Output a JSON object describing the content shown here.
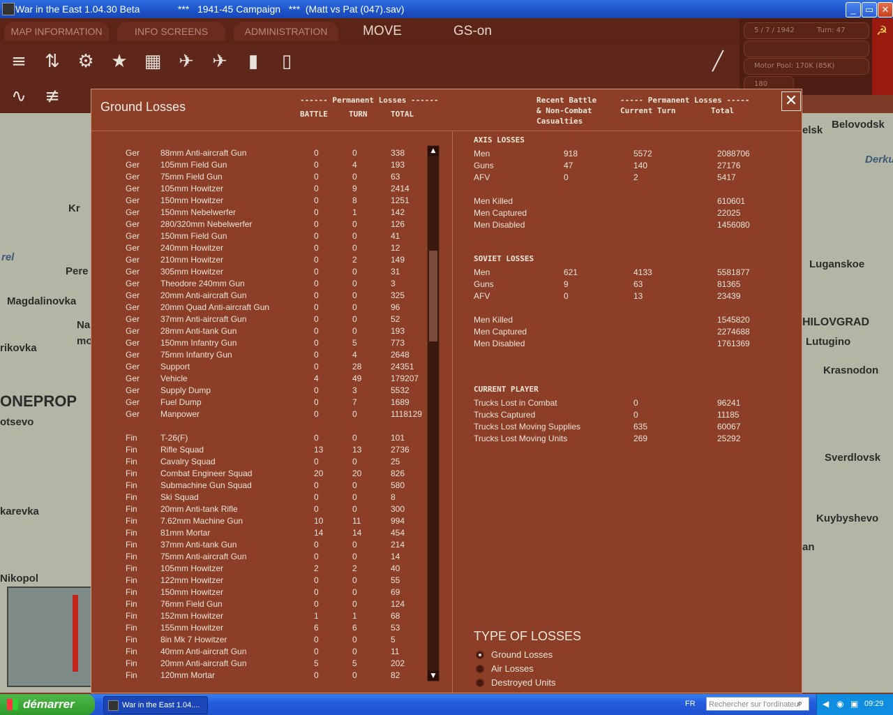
{
  "window": {
    "title": "War in the East 1.04.30 Beta              ***   1941-45 Campaign   ***  (Matt vs Pat (047).sav)",
    "min": "_",
    "max": "▭",
    "close": "✕"
  },
  "menu": {
    "tabs": [
      "MAP INFORMATION",
      "INFO SCREENS",
      "ADMINISTRATION"
    ],
    "mode": "MOVE",
    "gs": "GS-on"
  },
  "info": {
    "date": "5 / 7 / 1942",
    "turn": "Turn: 47",
    "motor_pool": "Motor Pool:  170K (85K)",
    "value": "180"
  },
  "map_labels": [
    "Belovodsk",
    "Derkul",
    "Luganskoe",
    "HILOVGRAD",
    "Lutugino",
    "Krasnodon",
    "Sverdlovsk",
    "Kuybyshevo",
    "Magdalinovka",
    "Pere",
    "Kr",
    "ONEPROP",
    "otsevo",
    "karevka",
    "Nikopol",
    "elsk",
    "rikovka",
    "an",
    "Na",
    "mo",
    "rel"
  ],
  "dialog": {
    "title": "Ground Losses",
    "close": "✕",
    "left_headers": {
      "group": "------ Permanent Losses ------",
      "battle": "BATTLE",
      "turn": "TURN",
      "total": "TOTAL"
    },
    "right_headers": {
      "recent": "Recent Battle\n& Non-Combat\nCasualties",
      "group": "----- Permanent Losses -----",
      "current": "Current Turn",
      "total": "Total"
    },
    "rows": [
      [
        "Ger",
        "88mm Anti-aircraft Gun",
        "0",
        "0",
        "338"
      ],
      [
        "Ger",
        "105mm Field Gun",
        "0",
        "4",
        "193"
      ],
      [
        "Ger",
        "75mm Field Gun",
        "0",
        "0",
        "63"
      ],
      [
        "Ger",
        "105mm Howitzer",
        "0",
        "9",
        "2414"
      ],
      [
        "Ger",
        "150mm Howitzer",
        "0",
        "8",
        "1251"
      ],
      [
        "Ger",
        "150mm Nebelwerfer",
        "0",
        "1",
        "142"
      ],
      [
        "Ger",
        "280/320mm Nebelwerfer",
        "0",
        "0",
        "126"
      ],
      [
        "Ger",
        "150mm Field Gun",
        "0",
        "0",
        "41"
      ],
      [
        "Ger",
        "240mm Howitzer",
        "0",
        "0",
        "12"
      ],
      [
        "Ger",
        "210mm Howitzer",
        "0",
        "2",
        "149"
      ],
      [
        "Ger",
        "305mm Howitzer",
        "0",
        "0",
        "31"
      ],
      [
        "Ger",
        "Theodore 240mm Gun",
        "0",
        "0",
        "3"
      ],
      [
        "Ger",
        "20mm Anti-aircraft Gun",
        "0",
        "0",
        "325"
      ],
      [
        "Ger",
        "20mm Quad Anti-aircraft Gun",
        "0",
        "0",
        "96"
      ],
      [
        "Ger",
        "37mm Anti-aircraft Gun",
        "0",
        "0",
        "52"
      ],
      [
        "Ger",
        "28mm Anti-tank Gun",
        "0",
        "0",
        "193"
      ],
      [
        "Ger",
        "150mm Infantry Gun",
        "0",
        "5",
        "773"
      ],
      [
        "Ger",
        "75mm Infantry Gun",
        "0",
        "4",
        "2648"
      ],
      [
        "Ger",
        "Support",
        "0",
        "28",
        "24351"
      ],
      [
        "Ger",
        "Vehicle",
        "4",
        "49",
        "179207"
      ],
      [
        "Ger",
        "Supply Dump",
        "0",
        "3",
        "5532"
      ],
      [
        "Ger",
        "Fuel Dump",
        "0",
        "7",
        "1689"
      ],
      [
        "Ger",
        "Manpower",
        "0",
        "0",
        "1118129"
      ],
      [
        "",
        "",
        "",
        "",
        ""
      ],
      [
        "Fin",
        "T-26(F)",
        "0",
        "0",
        "101"
      ],
      [
        "Fin",
        "Rifle Squad",
        "13",
        "13",
        "2736"
      ],
      [
        "Fin",
        "Cavalry Squad",
        "0",
        "0",
        "25"
      ],
      [
        "Fin",
        "Combat Engineer Squad",
        "20",
        "20",
        "826"
      ],
      [
        "Fin",
        "Submachine Gun Squad",
        "0",
        "0",
        "580"
      ],
      [
        "Fin",
        "Ski Squad",
        "0",
        "0",
        "8"
      ],
      [
        "Fin",
        "20mm Anti-tank Rifle",
        "0",
        "0",
        "300"
      ],
      [
        "Fin",
        "7.62mm Machine Gun",
        "10",
        "11",
        "994"
      ],
      [
        "Fin",
        "81mm Mortar",
        "14",
        "14",
        "454"
      ],
      [
        "Fin",
        "37mm Anti-tank Gun",
        "0",
        "0",
        "214"
      ],
      [
        "Fin",
        "75mm Anti-aircraft Gun",
        "0",
        "0",
        "14"
      ],
      [
        "Fin",
        "105mm Howitzer",
        "2",
        "2",
        "40"
      ],
      [
        "Fin",
        "122mm Howitzer",
        "0",
        "0",
        "55"
      ],
      [
        "Fin",
        "150mm Howitzer",
        "0",
        "0",
        "69"
      ],
      [
        "Fin",
        "76mm Field Gun",
        "0",
        "0",
        "124"
      ],
      [
        "Fin",
        "152mm Howitzer",
        "1",
        "1",
        "68"
      ],
      [
        "Fin",
        "155mm Howitzer",
        "6",
        "6",
        "53"
      ],
      [
        "Fin",
        "8in Mk 7 Howitzer",
        "0",
        "0",
        "5"
      ],
      [
        "Fin",
        "40mm Anti-aircraft Gun",
        "0",
        "0",
        "11"
      ],
      [
        "Fin",
        "20mm Anti-aircraft Gun",
        "5",
        "5",
        "202"
      ],
      [
        "Fin",
        "120mm Mortar",
        "0",
        "0",
        "82"
      ]
    ],
    "axis": {
      "title": "AXIS LOSSES",
      "rows": [
        [
          "Men",
          "918",
          "5572",
          "2088706"
        ],
        [
          "Guns",
          "47",
          "140",
          "27176"
        ],
        [
          "AFV",
          "0",
          "2",
          "5417"
        ]
      ],
      "details": [
        [
          "Men Killed",
          "610601"
        ],
        [
          "Men Captured",
          "22025"
        ],
        [
          "Men Disabled",
          "1456080"
        ]
      ]
    },
    "soviet": {
      "title": "SOVIET LOSSES",
      "rows": [
        [
          "Men",
          "621",
          "4133",
          "5581877"
        ],
        [
          "Guns",
          "9",
          "63",
          "81365"
        ],
        [
          "AFV",
          "0",
          "13",
          "23439"
        ]
      ],
      "details": [
        [
          "Men Killed",
          "1545820"
        ],
        [
          "Men Captured",
          "2274688"
        ],
        [
          "Men Disabled",
          "1761369"
        ]
      ]
    },
    "player": {
      "title": "CURRENT PLAYER",
      "rows": [
        [
          "Trucks Lost in Combat",
          "0",
          "96241"
        ],
        [
          "Trucks Captured",
          "0",
          "11185"
        ],
        [
          "Trucks Lost Moving Supplies",
          "635",
          "60067"
        ],
        [
          "Trucks Lost Moving Units",
          "269",
          "25292"
        ]
      ]
    },
    "type_of_losses": {
      "title": "TYPE OF LOSSES",
      "options": [
        "Ground Losses",
        "Air Losses",
        "Destroyed Units"
      ]
    }
  },
  "taskbar": {
    "start": "démarrer",
    "item": "War in the East 1.04....",
    "lang": "FR",
    "search_placeholder": "Rechercher sur l'ordinateur",
    "clock": "09:29"
  },
  "colors": {
    "dialog_bg": "#8c3e26",
    "title_bar": "#2f6fe0",
    "start_green": "#3fa83a"
  }
}
